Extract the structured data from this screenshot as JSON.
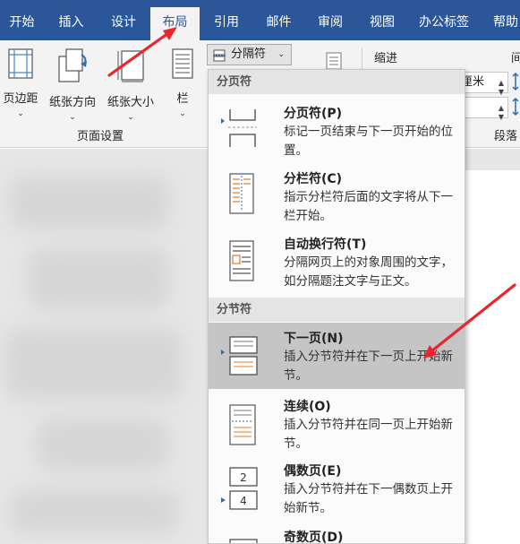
{
  "tabs": [
    "开始",
    "插入",
    "设计",
    "布局",
    "引用",
    "邮件",
    "审阅",
    "视图",
    "办公标签",
    "帮助"
  ],
  "active_tab": "布局",
  "ribbon": {
    "margins_label": "页边距",
    "orientation_label": "纸张方向",
    "size_label": "纸张大小",
    "columns_label": "栏",
    "group_page_setup": "页面设置",
    "breaks_label": "分隔符",
    "indent_label": "缩进",
    "spacing_label_partial": "间",
    "unit_partial": "厘米",
    "paragraph_group_partial": "段落"
  },
  "menu": {
    "page_breaks_header": "分页符",
    "section_breaks_header": "分节符",
    "items": [
      {
        "title": "分页符(P)",
        "desc": "标记一页结束与下一页开始的位置。",
        "icon": "page-break-icon"
      },
      {
        "title": "分栏符(C)",
        "desc": "指示分栏符后面的文字将从下一栏开始。",
        "icon": "column-break-icon"
      },
      {
        "title": "自动换行符(T)",
        "desc": "分隔网页上的对象周围的文字，如分隔题注文字与正文。",
        "icon": "text-wrapping-break-icon"
      },
      {
        "title": "下一页(N)",
        "desc": "插入分节符并在下一页上开始新节。",
        "icon": "next-page-section-icon"
      },
      {
        "title": "连续(O)",
        "desc": "插入分节符并在同一页上开始新节。",
        "icon": "continuous-section-icon"
      },
      {
        "title": "偶数页(E)",
        "desc": "插入分节符并在下一偶数页上开始新节。",
        "icon": "even-page-section-icon"
      },
      {
        "title": "奇数页(D)",
        "desc": "",
        "icon": "odd-page-section-icon"
      }
    ]
  },
  "colors": {
    "tab_bar": "#2b579a",
    "ribbon": "#f3f3f3",
    "highlight": "#c5c5c5",
    "annotation_arrow": "#e8262b"
  }
}
